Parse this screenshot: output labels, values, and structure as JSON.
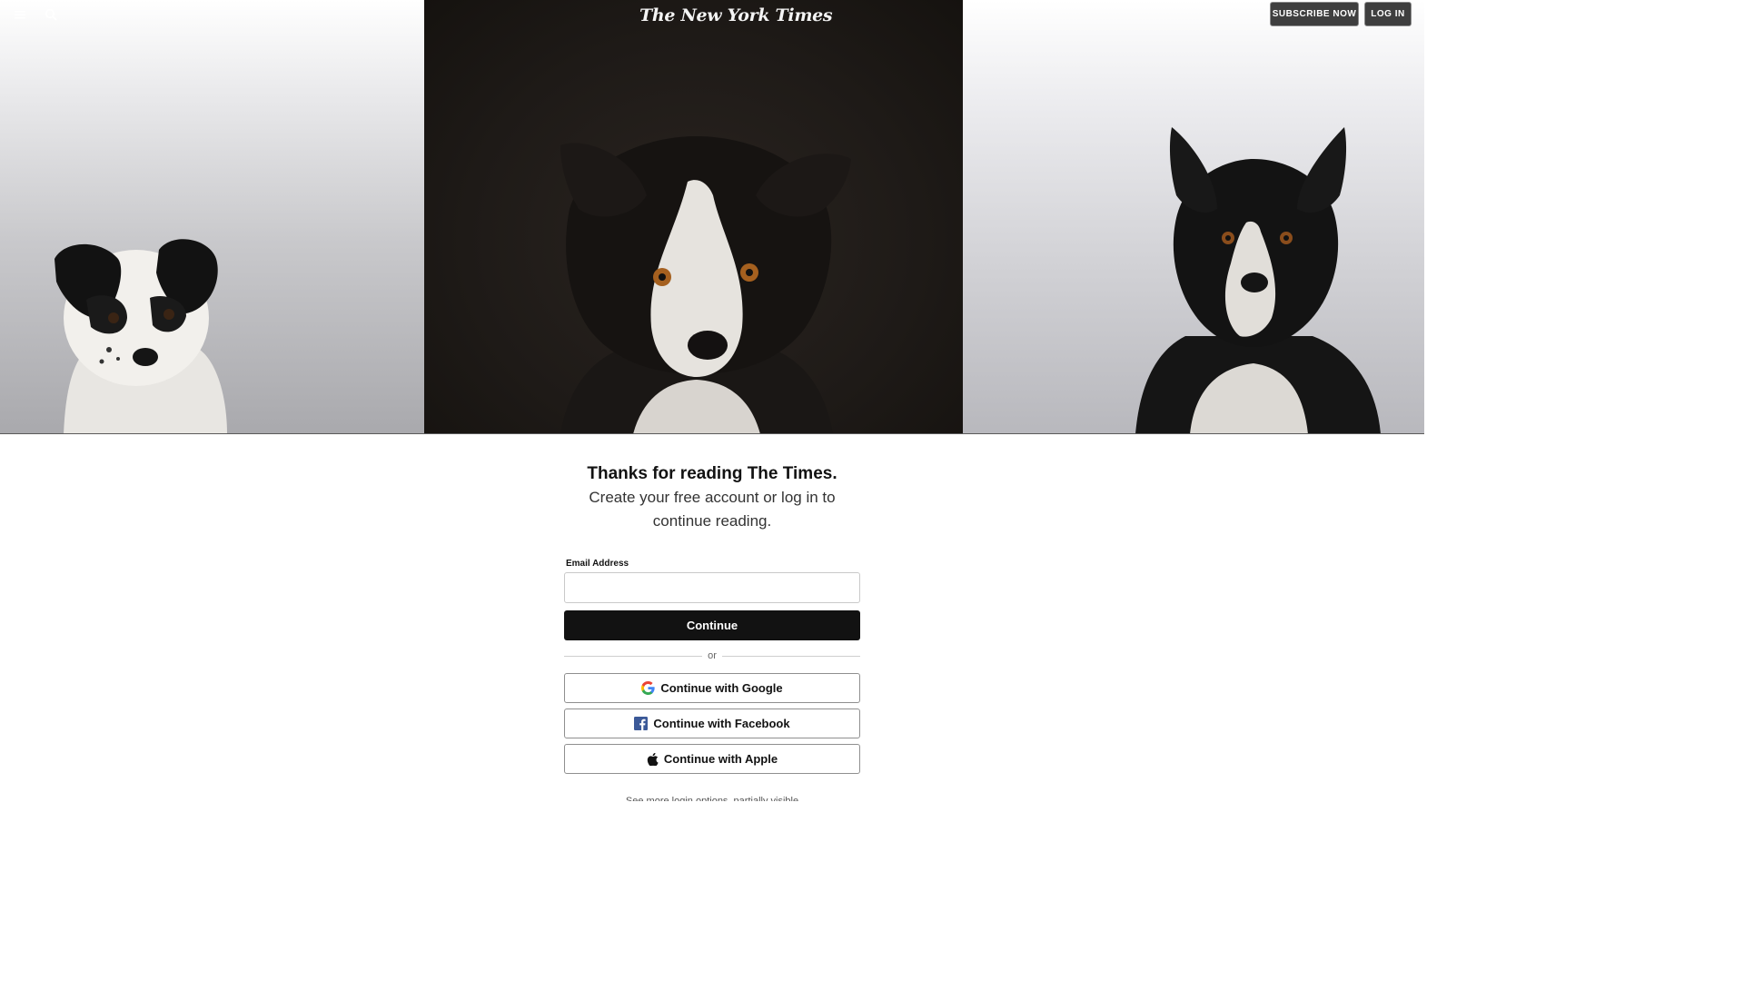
{
  "header": {
    "logo_text": "The New York Times",
    "menu_icon": "hamburger-menu-icon",
    "search_icon": "search-icon",
    "subscribe_label": "SUBSCRIBE NOW",
    "login_label": "LOG IN"
  },
  "hero": {
    "images": [
      "border-collie-puppy",
      "border-collie-dark-background",
      "border-collie-adult"
    ]
  },
  "login": {
    "headline": "Thanks for reading The Times.",
    "subhead": "Create your free account or log in to continue reading.",
    "email_label": "Email Address",
    "email_value": "",
    "email_placeholder": "",
    "continue_label": "Continue",
    "divider_text": "or",
    "google_label": "Continue with Google",
    "facebook_label": "Continue with Facebook",
    "apple_label": "Continue with Apple",
    "footnote": "See more login options, partially visible"
  },
  "colors": {
    "primary_button": "#121212",
    "hero_center_bg": "#1e1a17",
    "facebook_blue": "#3b5998",
    "top_button_bg": "#3f3f3f"
  }
}
